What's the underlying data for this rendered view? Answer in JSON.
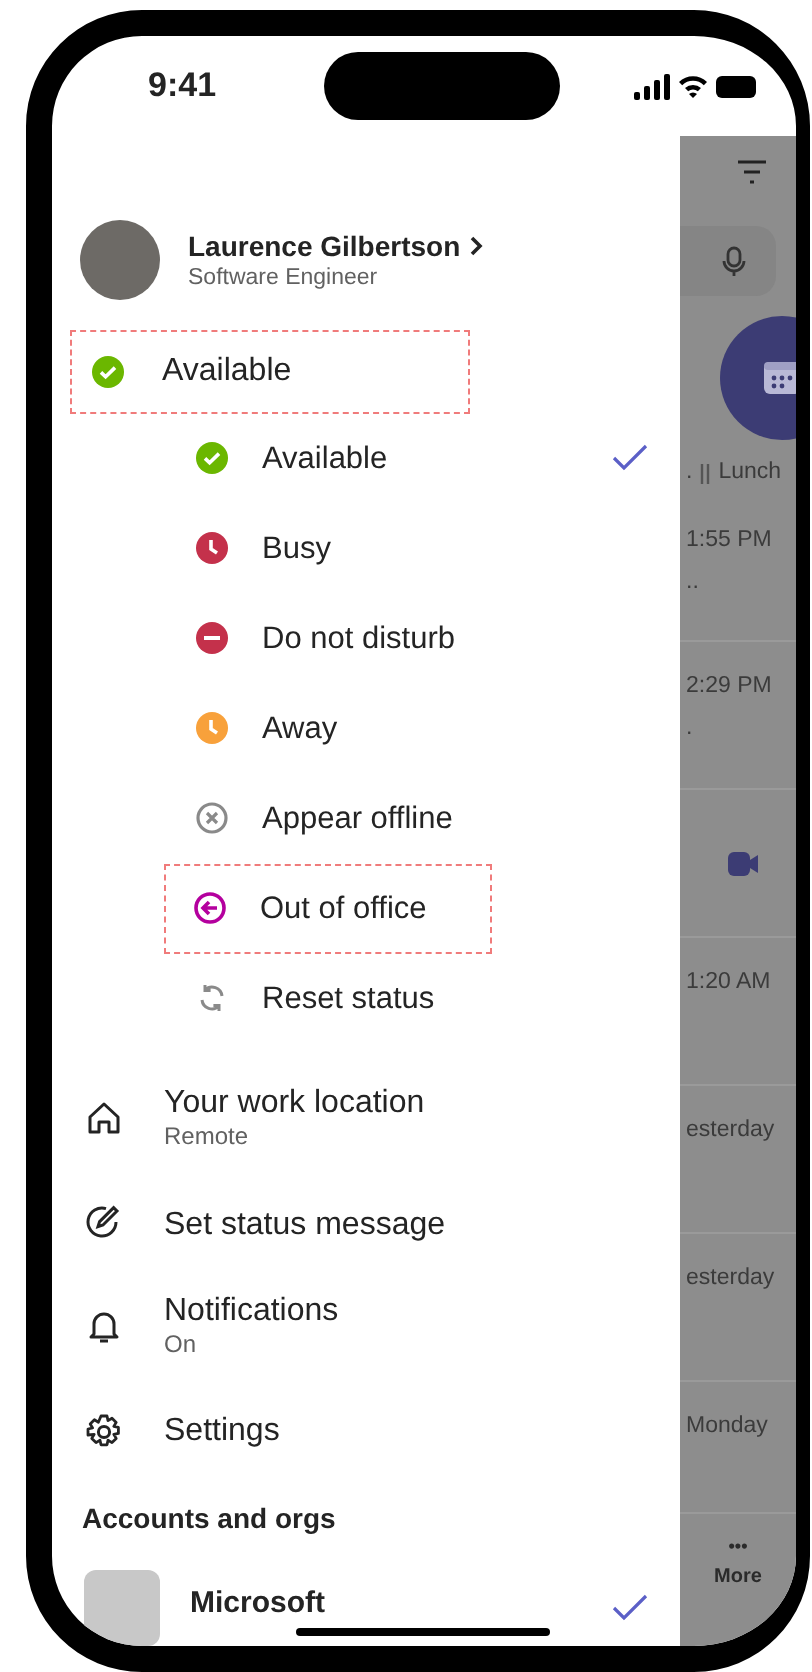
{
  "status_bar": {
    "time": "9:41"
  },
  "profile": {
    "name": "Laurence Gilbertson",
    "role": "Software Engineer"
  },
  "current_status": {
    "label": "Available",
    "kind": "available",
    "color": "#6bb700",
    "highlighted": true
  },
  "status_options": [
    {
      "label": "Available",
      "kind": "available",
      "color": "#6bb700",
      "selected": true,
      "highlighted": false
    },
    {
      "label": "Busy",
      "kind": "busy",
      "color": "#c4314b",
      "selected": false,
      "highlighted": false
    },
    {
      "label": "Do not disturb",
      "kind": "dnd",
      "color": "#c4314b",
      "selected": false,
      "highlighted": false
    },
    {
      "label": "Away",
      "kind": "away",
      "color": "#f8a13b",
      "selected": false,
      "highlighted": false
    },
    {
      "label": "Appear offline",
      "kind": "offline",
      "color": "#8a8a8a",
      "selected": false,
      "highlighted": false
    },
    {
      "label": "Out of office",
      "kind": "ooo",
      "color": "#b4009e",
      "selected": false,
      "highlighted": true
    },
    {
      "label": "Reset status",
      "kind": "reset",
      "color": "#8a8a8a",
      "selected": false,
      "highlighted": false
    }
  ],
  "menu_items": [
    {
      "label": "Your work location",
      "sublabel": "Remote",
      "kind": "location"
    },
    {
      "label": "Set status message",
      "kind": "message"
    },
    {
      "label": "Notifications",
      "sublabel": "On",
      "kind": "notifications"
    },
    {
      "label": "Settings",
      "kind": "settings"
    }
  ],
  "accounts": {
    "heading": "Accounts and orgs",
    "items": [
      {
        "name": "Microsoft",
        "selected": true
      }
    ]
  },
  "background": {
    "rows": [
      {
        "kind": "event",
        "prefix": ".",
        "text": "Lunch"
      },
      {
        "kind": "chat",
        "time": "1:55 PM",
        "preview": ".."
      },
      {
        "kind": "chat",
        "time": "2:29 PM",
        "preview": "."
      },
      {
        "kind": "meeting"
      },
      {
        "kind": "chat",
        "time": "1:20 AM"
      },
      {
        "kind": "chat",
        "time": "esterday"
      },
      {
        "kind": "chat",
        "time": "esterday"
      },
      {
        "kind": "chat",
        "time": "Monday"
      }
    ],
    "more_label": "More",
    "more_dots": "•••"
  }
}
